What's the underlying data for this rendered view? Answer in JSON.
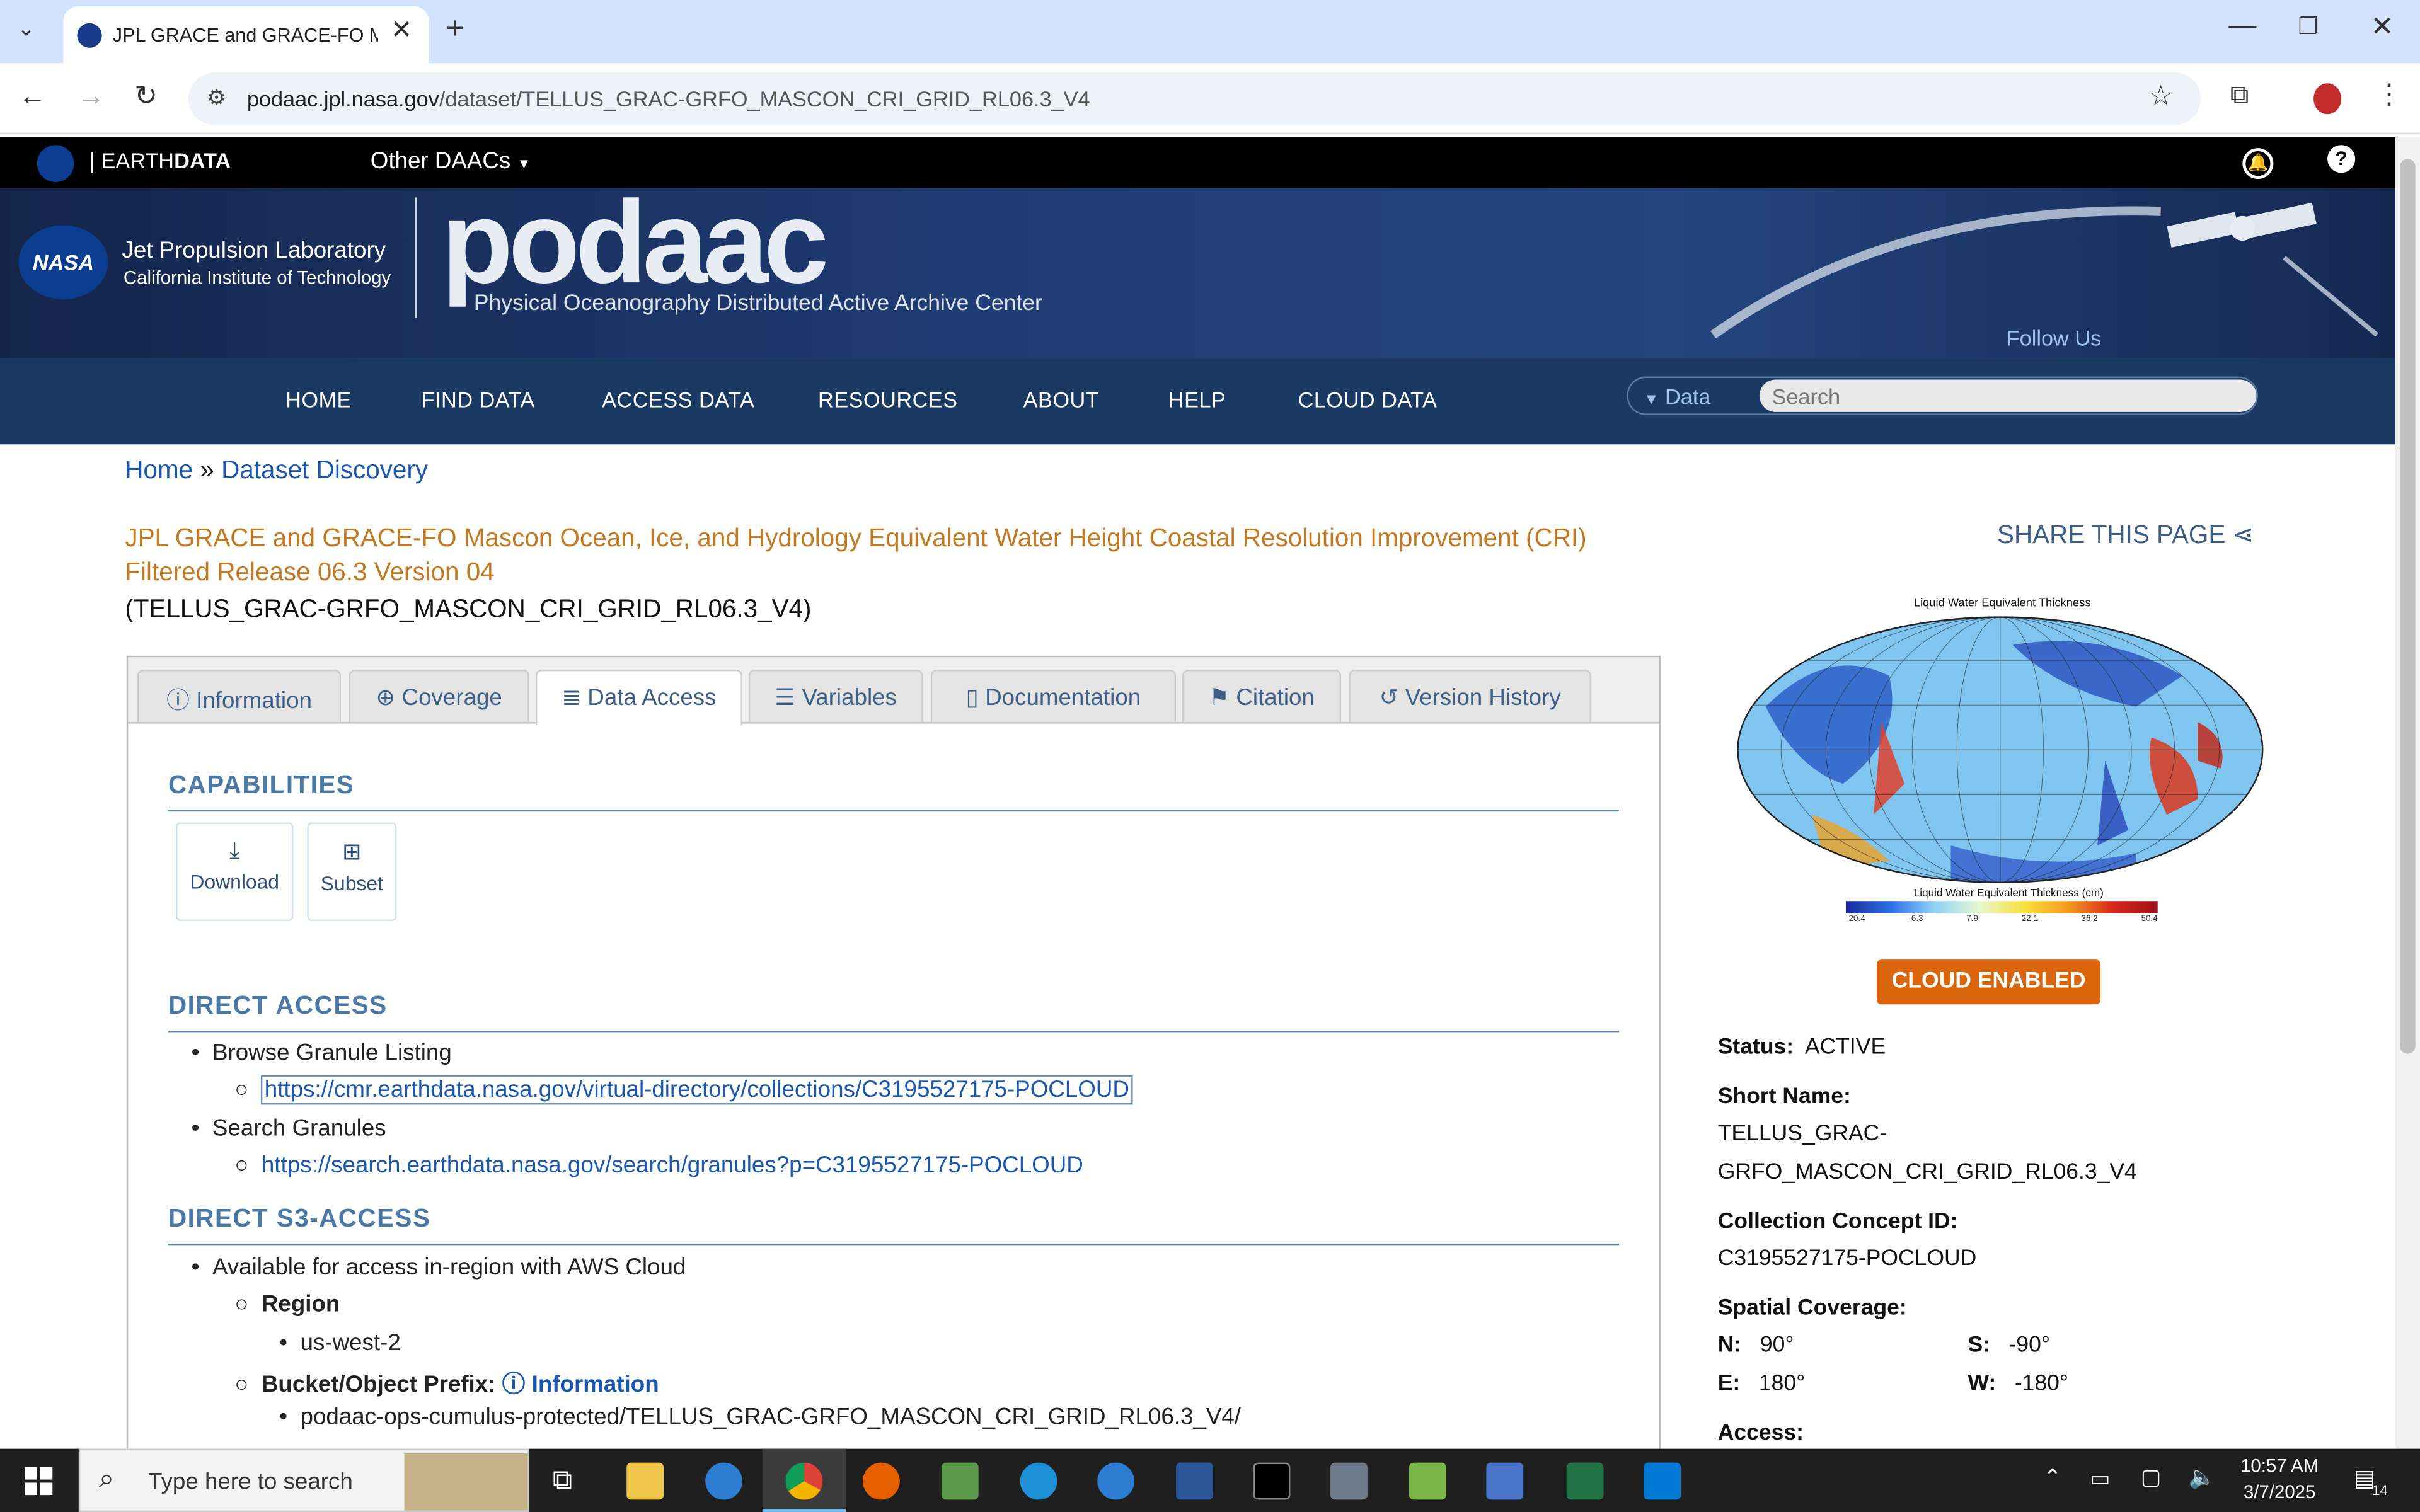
{
  "browser": {
    "tab_title": "JPL GRACE and GRACE-FO Mas",
    "url_host": "podaac.jpl.nasa.gov",
    "url_path": "/dataset/TELLUS_GRAC-GRFO_MASCON_CRI_GRID_RL06.3_V4"
  },
  "earthdata": {
    "brand_left": "EARTH",
    "brand_right": "DATA",
    "other_daacs": "Other DAACs"
  },
  "header": {
    "jpl_line1": "Jet Propulsion Laboratory",
    "jpl_line2": "California Institute of Technology",
    "logo_text": "podaac",
    "logo_subtitle": "Physical Oceanography Distributed Active Archive Center",
    "follow_us": "Follow Us",
    "nasa_label": "NASA"
  },
  "nav": {
    "items": [
      "HOME",
      "FIND DATA",
      "ACCESS DATA",
      "RESOURCES",
      "ABOUT",
      "HELP",
      "CLOUD DATA"
    ],
    "search_scope": "Data",
    "search_placeholder": "Search"
  },
  "breadcrumb": {
    "home": "Home",
    "sep": "»",
    "current": "Dataset Discovery"
  },
  "dataset": {
    "title_line1": "JPL GRACE and GRACE-FO Mascon Ocean, Ice, and Hydrology Equivalent Water Height Coastal Resolution Improvement (CRI)",
    "title_line2": "Filtered Release 06.3 Version 04",
    "short_name_paren": "(TELLUS_GRAC-GRFO_MASCON_CRI_GRID_RL06.3_V4)",
    "share": "SHARE THIS PAGE"
  },
  "tabs": [
    "Information",
    "Coverage",
    "Data Access",
    "Variables",
    "Documentation",
    "Citation",
    "Version History"
  ],
  "content": {
    "capabilities": "CAPABILITIES",
    "download": "Download",
    "subset": "Subset",
    "direct_access": "DIRECT ACCESS",
    "browse_granule": "Browse Granule Listing",
    "browse_url": "https://cmr.earthdata.nasa.gov/virtual-directory/collections/C3195527175-POCLOUD",
    "search_granules": "Search Granules",
    "search_url": "https://search.earthdata.nasa.gov/search/granules?p=C3195527175-POCLOUD",
    "direct_s3": "DIRECT S3-ACCESS",
    "aws_text": "Available for access in-region with AWS Cloud",
    "region_label": "Region",
    "region_value": "us-west-2",
    "bucket_label": "Bucket/Object Prefix:",
    "info_link": "Information",
    "bucket_value": "podaac-ops-cumulus-protected/TELLUS_GRAC-GRFO_MASCON_CRI_GRID_RL06.3_V4/"
  },
  "sidebar": {
    "map_title": "Liquid Water Equivalent Thickness",
    "colorbar_title": "Liquid Water Equivalent Thickness (cm)",
    "colorbar_ticks": [
      "-20.4",
      "-6.3",
      "7.9",
      "22.1",
      "36.2",
      "50.4"
    ],
    "cloud_badge": "CLOUD ENABLED",
    "status_label": "Status:",
    "status_value": "ACTIVE",
    "short_name_label": "Short Name:",
    "short_name_line1": "TELLUS_GRAC-",
    "short_name_line2": "GRFO_MASCON_CRI_GRID_RL06.3_V4",
    "concept_label": "Collection Concept ID:",
    "concept_value": "C3195527175-POCLOUD",
    "spatial_label": "Spatial Coverage:",
    "n_label": "N:",
    "n_value": "90°",
    "s_label": "S:",
    "s_value": "-90°",
    "e_label": "E:",
    "e_value": "180°",
    "w_label": "W:",
    "w_value": "-180°",
    "access_label": "Access:"
  },
  "taskbar": {
    "search_placeholder": "Type here to search",
    "time": "10:57 AM",
    "date": "3/7/2025",
    "notif_count": "14"
  },
  "colors": {
    "nav_bg": "#1a3a63",
    "section_heading": "#4a79a8",
    "title_orange": "#c27a22",
    "cloud_badge": "#d9650c",
    "link": "#1a57b0"
  }
}
